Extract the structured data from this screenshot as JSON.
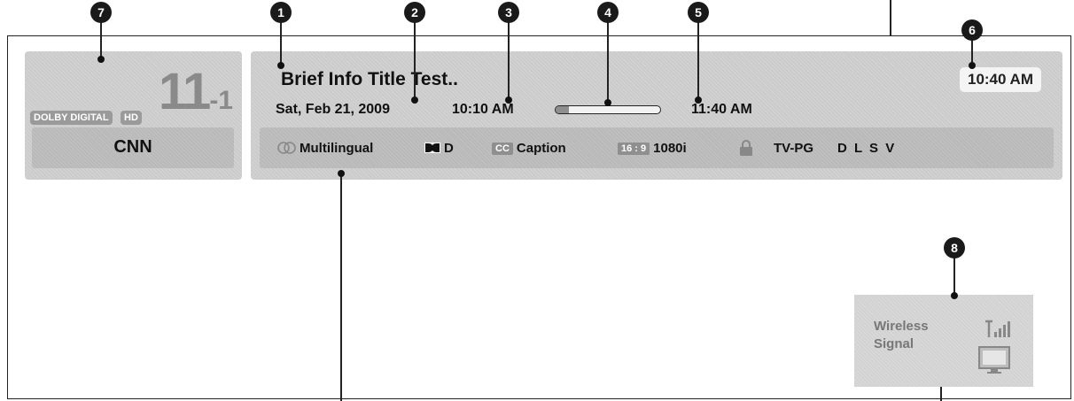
{
  "callouts": [
    "1",
    "2",
    "3",
    "4",
    "5",
    "6",
    "7",
    "8"
  ],
  "channel": {
    "badge_audio": "DOLBY DIGITAL",
    "badge_hd": "HD",
    "number_major": "11",
    "number_minor": "-1",
    "name": "CNN"
  },
  "program": {
    "title": "Brief Info Title Test..",
    "date": "Sat, Feb 21, 2009",
    "start_time": "10:10 AM",
    "end_time": "11:40 AM",
    "progress": 0.13,
    "current_time": "10:40 AM"
  },
  "details": {
    "audio_label": "Multilingual",
    "dolby_label": "D",
    "cc_badge": "CC",
    "caption_label": "Caption",
    "aspect_badge": "16 : 9",
    "resolution": "1080i",
    "rating": "TV-PG",
    "rating_descriptors": "D L S V"
  },
  "wireless": {
    "line1": "Wireless",
    "line2": "Signal"
  },
  "colors": {
    "panel": "#cbcbcb",
    "badge": "#9a9a9a",
    "callout": "#1a1a1a"
  }
}
